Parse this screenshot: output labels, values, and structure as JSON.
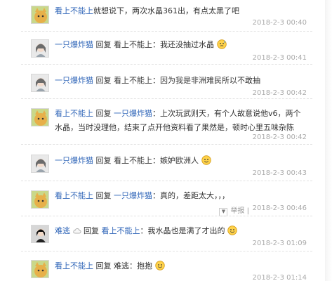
{
  "comments": [
    {
      "user": "看上不能上",
      "reply_label": "",
      "reply_to": "",
      "text": "就想说下，两次水晶361出，有点太黑了吧",
      "time": "2018-2-3 00:40",
      "avatar": "cat-avatar",
      "emoji": ""
    },
    {
      "user": "一只爆炸猫",
      "reply_label": "回复",
      "reply_to": "看上不能上",
      "text": "：我还没抽过水晶",
      "time": "2018-2-3 00:41",
      "avatar": "girl-avatar",
      "emoji": "sweat-emoji"
    },
    {
      "user": "一只爆炸猫",
      "reply_label": "回复",
      "reply_to": "看上不能上",
      "text": "：因为我是非洲难民所以不敢抽",
      "time": "2018-2-3 00:42",
      "avatar": "girl-avatar",
      "emoji": ""
    },
    {
      "user": "看上不能上",
      "reply_label": "回复",
      "reply_to": "一只爆炸猫",
      "text": "：上次玩武则天，有个人故意说他v6，两个水晶，当时没理他，结束了点开他资料看了果然是，顿时心里五味杂陈",
      "time": "2018-2-3 00:42",
      "avatar": "cat-avatar",
      "emoji": ""
    },
    {
      "user": "一只爆炸猫",
      "reply_label": "回复",
      "reply_to": "看上不能上",
      "text": "：嫉妒欧洲人",
      "time": "2018-2-3 00:43",
      "avatar": "girl-avatar",
      "emoji": "smile-emoji"
    },
    {
      "user": "看上不能上",
      "reply_label": "回复",
      "reply_to": "一只爆炸猫",
      "text": "：真的，差距太大，，，",
      "time": "2018-2-3 00:46",
      "avatar": "cat-avatar",
      "emoji": "",
      "report_label": "举报"
    },
    {
      "user": "难逃",
      "reply_label": "回复",
      "reply_to": "看上不能上",
      "text": "：我水晶也是满了才出的",
      "time": "2018-2-3 01:09",
      "avatar": "dark-avatar",
      "emoji": "smile-emoji",
      "badge": "cloud-badge"
    },
    {
      "user": "看上不能上",
      "reply_label": "回复",
      "reply_to": "难逃",
      "text": "：抱抱",
      "time": "2018-2-3 01:14",
      "avatar": "cat-avatar",
      "emoji": "smile-emoji"
    }
  ],
  "colors": {
    "link": "#2f65b8",
    "time": "#aaaaaa"
  }
}
